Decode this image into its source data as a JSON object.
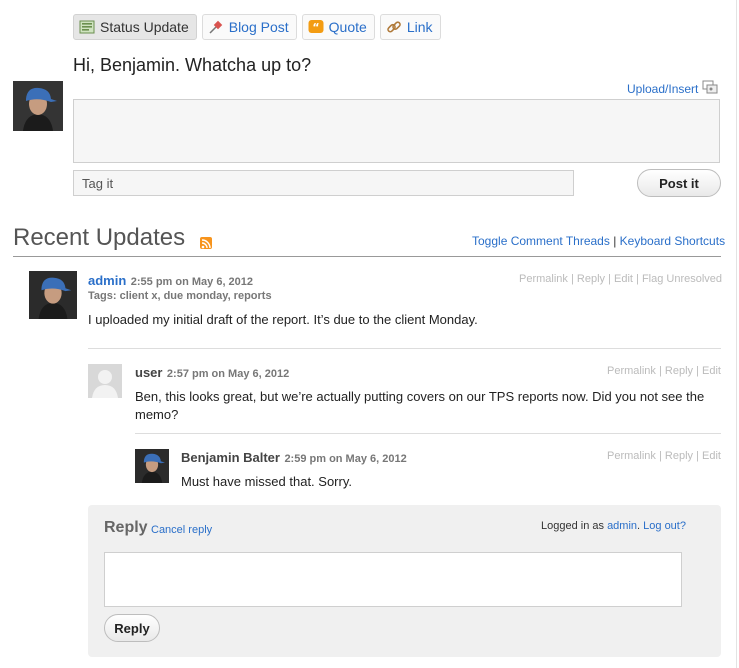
{
  "tabs": [
    {
      "label": "Status Update",
      "icon": "status-update-icon",
      "active": true
    },
    {
      "label": "Blog Post",
      "icon": "pin-icon"
    },
    {
      "label": "Quote",
      "icon": "quote-icon"
    },
    {
      "label": "Link",
      "icon": "link-icon"
    }
  ],
  "composer": {
    "greeting": "Hi, Benjamin. Whatcha up to?",
    "upload_link": "Upload/Insert",
    "tag_placeholder": "Tag it",
    "post_label": "Post it"
  },
  "recent": {
    "title": "Recent Updates",
    "toggle_link": "Toggle Comment Threads",
    "separator": "|",
    "shortcuts_link": "Keyboard Shortcuts"
  },
  "post": {
    "author": "admin",
    "time": "2:55 pm on May 6, 2012",
    "tags": "Tags: client x, due monday, reports",
    "actions": [
      "Permalink",
      "Reply",
      "Edit",
      "Flag Unresolved"
    ],
    "text": "I uploaded my initial draft of the report. It’s due to the client Monday."
  },
  "comment1": {
    "author": "user",
    "time": "2:57 pm on May 6, 2012",
    "actions": [
      "Permalink",
      "Reply",
      "Edit"
    ],
    "text": "Ben, this looks great, but we’re actually putting covers on our TPS reports now. Did you not see the memo?"
  },
  "comment2": {
    "author": "Benjamin Balter",
    "time": "2:59 pm on May 6, 2012",
    "actions": [
      "Permalink",
      "Reply",
      "Edit"
    ],
    "text": "Must have missed that. Sorry."
  },
  "reply": {
    "title": "Reply",
    "cancel": "Cancel reply",
    "logged_in_prefix": "Logged in as",
    "user": "admin",
    "logout": "Log out?",
    "button": "Reply"
  },
  "colors": {
    "link": "#2a6fc9",
    "rss": "#f7941d",
    "quote": "#f39c12"
  }
}
